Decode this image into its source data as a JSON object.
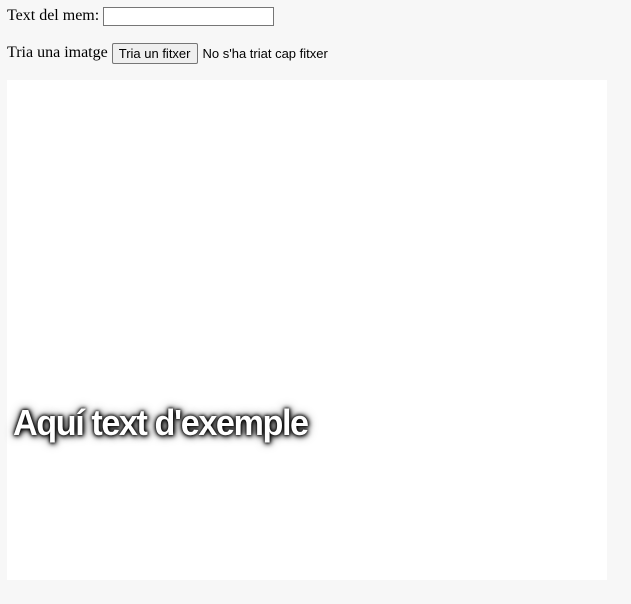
{
  "form": {
    "text_label": "Text del mem:",
    "text_value": "",
    "image_label": "Tria una imatge",
    "file_button_label": "Tria un fitxer",
    "file_status": "No s'ha triat cap fitxer"
  },
  "canvas": {
    "meme_text": "Aquí text d'exemple",
    "background": "#ffffff",
    "text_color": "#ffffff"
  }
}
